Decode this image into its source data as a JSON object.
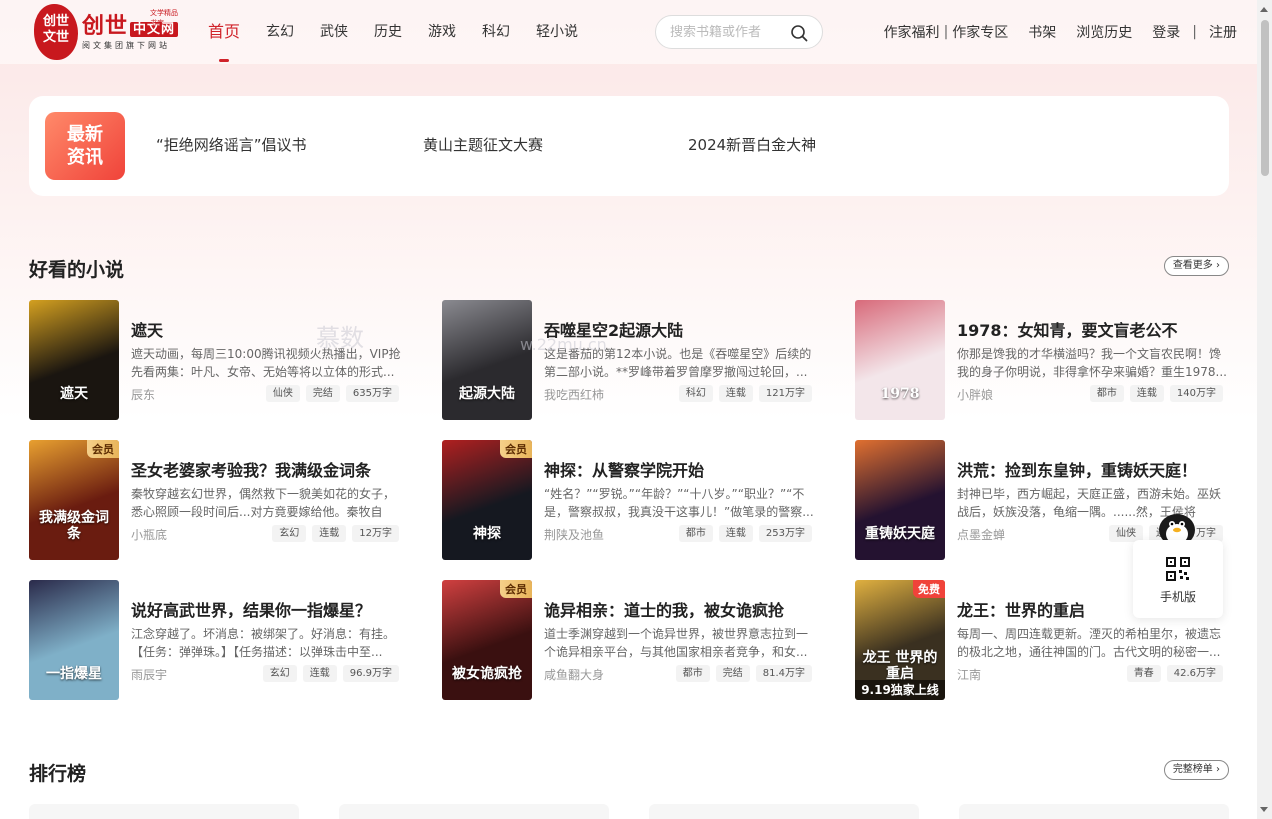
{
  "brand": {
    "seal_text": "创世文世",
    "name": "创世",
    "name_suffix": "中文网",
    "tagline": "文学精品书库",
    "sub": "阅文集团旗下网站"
  },
  "nav": {
    "items": [
      {
        "label": "首页",
        "active": true
      },
      {
        "label": "玄幻",
        "active": false
      },
      {
        "label": "武侠",
        "active": false
      },
      {
        "label": "历史",
        "active": false
      },
      {
        "label": "游戏",
        "active": false
      },
      {
        "label": "科幻",
        "active": false
      },
      {
        "label": "轻小说",
        "active": false
      }
    ]
  },
  "search": {
    "placeholder": "搜索书籍或作者",
    "icon": "search-icon"
  },
  "top_links": {
    "writer": "作家福利",
    "writer_sep": "|",
    "writer_zone": "作家专区",
    "bookshelf": "书架",
    "history": "浏览历史",
    "login": "登录",
    "login_sep": "|",
    "register": "注册"
  },
  "news": {
    "badge": "最新资讯",
    "items": [
      "“拒绝网络谣言”倡议书",
      "黄山主题征文大赛",
      "2024新晋白金大神"
    ]
  },
  "section_good": {
    "title": "好看的小说",
    "more": "查看更多 ›"
  },
  "books": [
    {
      "title": "遮天",
      "desc": "遮天动画，每周三10:00腾讯视频火热播出，VIP抢先看两集：叶凡、女帝、无始等将以立体的形式...",
      "author": "辰东",
      "tags": [
        "仙侠",
        "完结",
        "635万字"
      ],
      "badge": "",
      "cover_text": "遮天",
      "cover_color": "#1a1510",
      "accent": "#d4a020"
    },
    {
      "title": "吞噬星空2起源大陆",
      "desc": "这是番茄的第12本小说。也是《吞噬星空》后续的第二部小说。**罗峰带着罗曾摩罗撤闯过轮回，...",
      "author": "我吃西红柿",
      "tags": [
        "科幻",
        "连载",
        "121万字"
      ],
      "badge": "",
      "cover_text": "起源大陆",
      "cover_color": "#2b2a2e",
      "accent": "#8a8a90"
    },
    {
      "title": "1978：女知青，要文盲老公不",
      "desc": "你那是馋我的才华横溢吗？我一个文盲农民啊！馋我的身子你明说，非得拿怀孕来骗婚？重生1978...",
      "author": "小胖娘",
      "tags": [
        "都市",
        "连载",
        "140万字"
      ],
      "badge": "",
      "cover_text": "1978",
      "cover_color": "#f3e6ea",
      "accent": "#d86a7a"
    },
    {
      "title": "圣女老婆家考验我？我满级金词条",
      "desc": "秦牧穿越玄幻世界，偶然救下一貌美如花的女子，悉心照顾一段时间后...对方竟要嫁给他。秦牧自然...",
      "author": "小瓶底",
      "tags": [
        "玄幻",
        "连载",
        "12万字"
      ],
      "badge": "会员",
      "cover_text": "我满级金词条",
      "cover_color": "#6a1c10",
      "accent": "#e8a030"
    },
    {
      "title": "神探：从警察学院开始",
      "desc": "“姓名？”“罗锐。”“年龄？”“十八岁。”“职业？”“不是，警察叔叔，我真没干这事儿！”做笔录的警察...",
      "author": "荆陕及池鱼",
      "tags": [
        "都市",
        "连载",
        "253万字"
      ],
      "badge": "会员",
      "cover_text": "神探",
      "cover_color": "#151820",
      "accent": "#b02020"
    },
    {
      "title": "洪荒：捡到东皇钟，重铸妖天庭！",
      "desc": "封神已毕，西方崛起，天庭正盛，西游未始。巫妖战后，妖族没落，龟缩一隅。......然，王侯将相，...",
      "author": "点墨金蝉",
      "tags": [
        "仙侠",
        "连载",
        "万字"
      ],
      "badge": "",
      "cover_text": "重铸妖天庭",
      "cover_color": "#241230",
      "accent": "#e07030"
    },
    {
      "title": "说好高武世界，结果你一指爆星？",
      "desc": "江念穿越了。坏消息：被绑架了。好消息：有挂。【任务：弹弹珠。】【任务描述：以弹珠击中至...",
      "author": "雨辰宇",
      "tags": [
        "玄幻",
        "连载",
        "96.9万字"
      ],
      "badge": "",
      "cover_text": "一指爆星",
      "cover_color": "#7fb0c8",
      "accent": "#2a2a4a"
    },
    {
      "title": "诡异相亲：道士的我，被女诡疯抢",
      "desc": "道士季渊穿越到一个诡异世界，被世界意志拉到一个诡异相亲平台，与其他国家相亲者竞争，和女...",
      "author": "咸鱼翻大身",
      "tags": [
        "都市",
        "完结",
        "81.4万字"
      ],
      "badge": "会员",
      "cover_text": "被女诡疯抢",
      "cover_color": "#3a1010",
      "accent": "#d04040"
    },
    {
      "title": "龙王：世界的重启",
      "desc": "每周一、周四连载更新。湮灭的希柏里尔，被遗忘的极北之地，通往神国的门。古代文明的秘密一...",
      "author": "江南",
      "tags": [
        "青春",
        "42.6万字"
      ],
      "badge": "免费",
      "cover_text": "龙王 世界的重启",
      "cover_color": "#3a3020",
      "accent": "#e0b040",
      "cover_footer": "9.19独家上线"
    }
  ],
  "section_rank": {
    "title": "排行榜",
    "more": "完整榜单 ›"
  },
  "float": {
    "qr_label": "手机版",
    "icon": "qr-code-icon"
  },
  "watermark": {
    "text": "慕数",
    "text2": "w.22mu.cn"
  },
  "colors": {
    "accent": "#d0232a",
    "news_badge": "#f0433a",
    "vip_badge": "#e8b45a"
  }
}
